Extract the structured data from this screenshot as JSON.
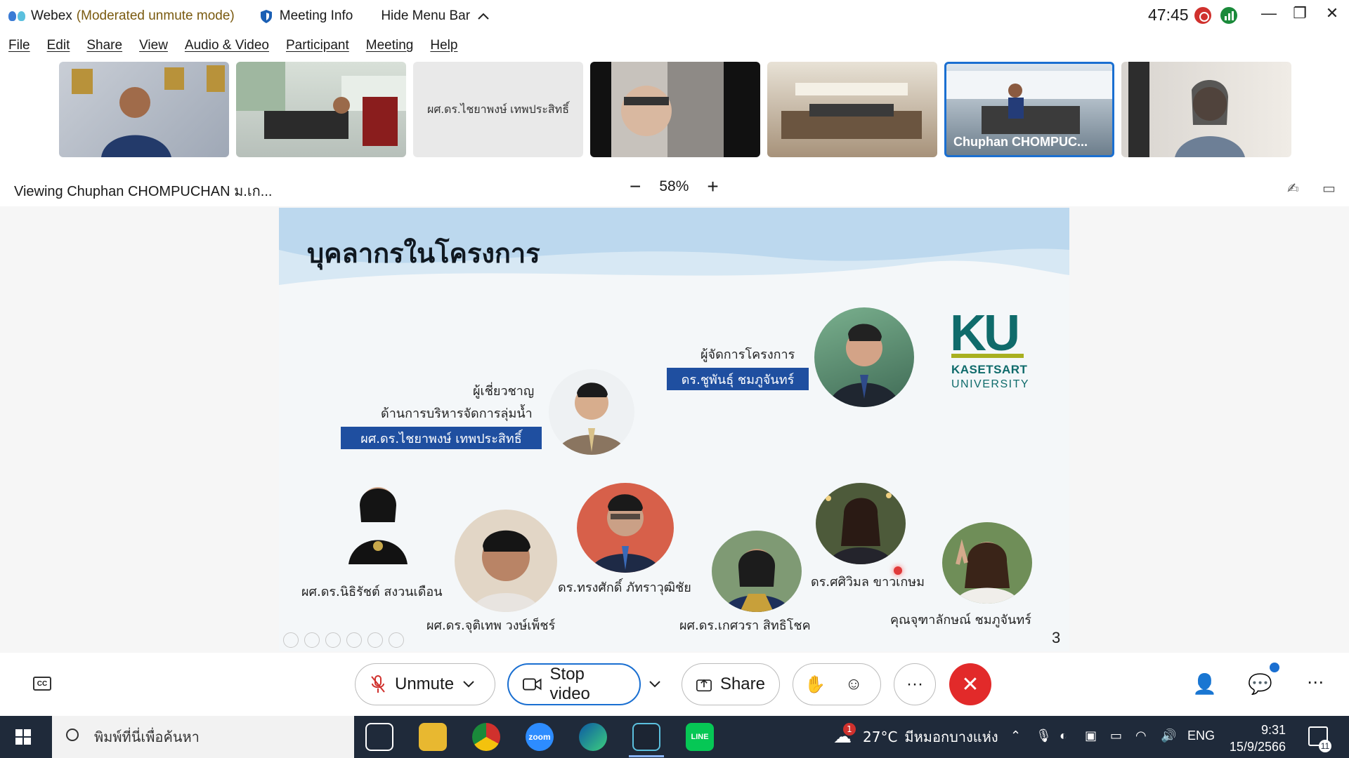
{
  "window": {
    "app_name": "Webex",
    "mode": "(Moderated unmute mode)",
    "meeting_info": "Meeting Info",
    "hide_menu": "Hide Menu Bar",
    "timer": "47:45"
  },
  "menu": [
    "File",
    "Edit",
    "Share",
    "View",
    "Audio & Video",
    "Participant",
    "Meeting",
    "Help"
  ],
  "thumbnails": [
    {
      "label": ""
    },
    {
      "label": ""
    },
    {
      "label": "ผศ.ดร.ไชยาพงษ์ เทพประสิทธิ์"
    },
    {
      "label": ""
    },
    {
      "label": ""
    },
    {
      "label": "Chuphan CHOMPUC..."
    },
    {
      "label": ""
    }
  ],
  "viewing": {
    "text": "Viewing Chuphan CHOMPUCHAN ม.เก...",
    "zoom": "58%",
    "minus": "−",
    "plus": "+"
  },
  "slide": {
    "title": "บุคลากรในโครงการ",
    "manager_role": "ผู้จัดการโครงการ",
    "manager_name": "ดร.ชูพันธุ์ ชมภูจันทร์",
    "expert_role1": "ผู้เชี่ยวชาญ",
    "expert_role2": "ด้านการบริหารจัดการลุ่มน้ำ",
    "expert_name": "ผศ.ดร.ไชยาพงษ์ เทพประสิทธิ์",
    "p1": "ผศ.ดร.นิธิรัชต์ สงวนเดือน",
    "p2": "ผศ.ดร.จุติเทพ วงษ์เพ็ชร์",
    "p3": "ดร.ทรงศักดิ์ ภัทราวุฒิชัย",
    "p4": "ผศ.ดร.เกศวรา สิทธิโชค",
    "p5": "ดร.ศศิวิมล ขาวเกษม",
    "p6": "คุณจุฑาลักษณ์ ชมภูจันทร์",
    "ku_mark": "KU",
    "ku_name1": "KASETSART",
    "ku_name2": "UNIVERSITY",
    "page": "3"
  },
  "controls": {
    "unmute": "Unmute",
    "stop_video": "Stop video",
    "share": "Share",
    "more": "···",
    "cc": "CC"
  },
  "taskbar": {
    "search_placeholder": "พิมพ์ที่นี่เพื่อค้นหา",
    "zoom_label": "zoom",
    "line_label": "LINE",
    "weather_temp": "27°C",
    "weather_place": "มีหมอกบางแห่ง",
    "weather_badge": "1",
    "lang": "ENG",
    "time": "9:31",
    "date": "15/9/2566",
    "notif_count": "11"
  },
  "colors": {
    "accent": "#1a6fd1",
    "leave": "#e22a2a",
    "namebox": "#1f4fa0",
    "ku_green": "#0f6b6b"
  }
}
